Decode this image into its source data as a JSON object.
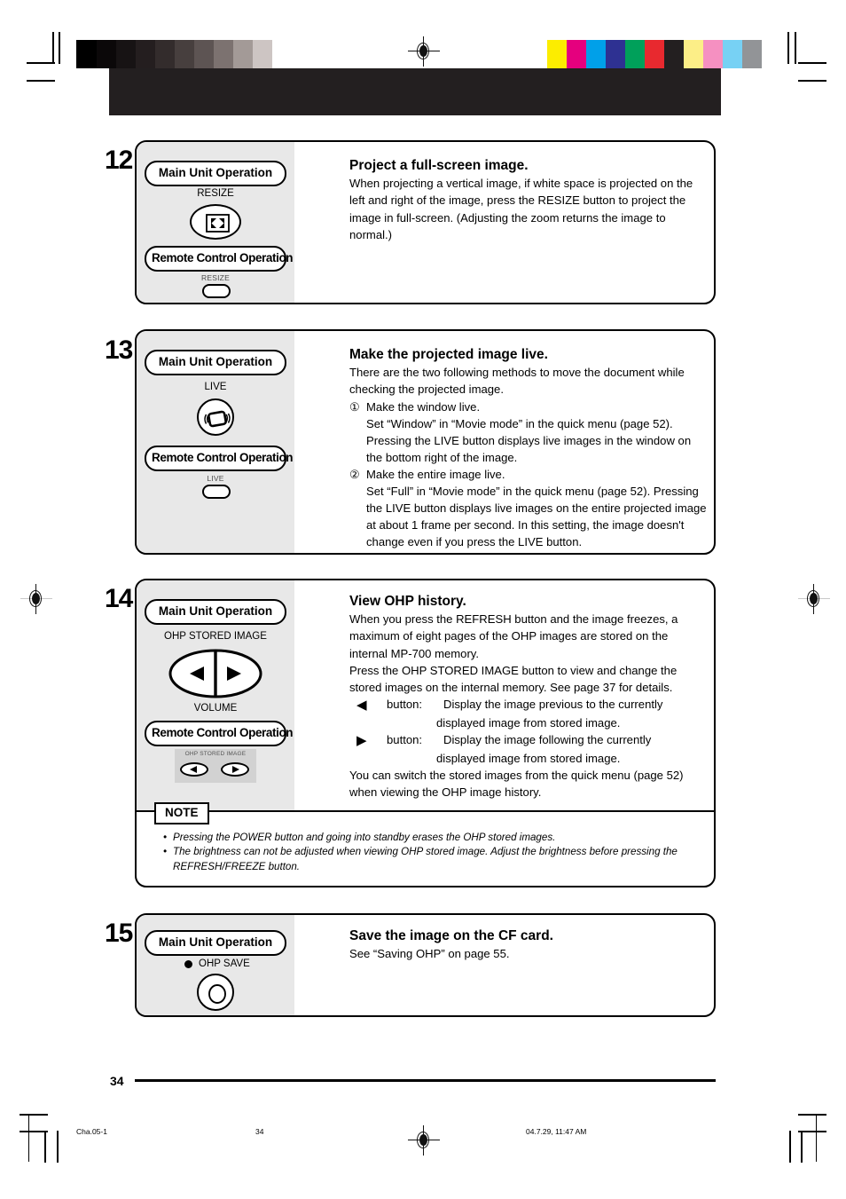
{
  "document": {
    "page_number": "34",
    "footer_file": "Cha.05-1",
    "footer_page": "34",
    "footer_timestamp": "04.7.29, 11:47 AM"
  },
  "labels": {
    "main_unit": "Main Unit Operation",
    "remote_control": "Remote Control Operation"
  },
  "colorbars": {
    "gray_swatches": [
      "#000000",
      "#0b0809",
      "#171314",
      "#241e1f",
      "#332c2c",
      "#473f3e",
      "#5d5453",
      "#7c7270",
      "#a39a97",
      "#cdc5c3",
      "#ffffff"
    ],
    "color_swatches": [
      "#fced00",
      "#e5007e",
      "#00a0e9",
      "#2e3192",
      "#00a05a",
      "#e8292f",
      "#231f20",
      "#fcee87",
      "#f590c1",
      "#77d1f4",
      "#929497"
    ]
  },
  "steps": [
    {
      "number": "12",
      "main_caption": "RESIZE",
      "main_icon": "resize-icon",
      "remote_caption": "RESIZE",
      "heading": "Project a full-screen image.",
      "body": "When projecting a vertical image, if white space is projected on the left and right of the image, press the RESIZE button to project the image in full-screen. (Adjusting the zoom returns the image to normal.)"
    },
    {
      "number": "13",
      "main_caption": "LIVE",
      "main_icon": "live-icon",
      "remote_caption": "LIVE",
      "heading": "Make the projected image live.",
      "intro": "There are the two following methods to move the document while checking the projected image.",
      "items": [
        {
          "marker": "①",
          "title": "Make the window live.",
          "detail": "Set “Window” in “Movie mode” in the quick menu (page 52). Pressing the LIVE button displays live images in the window on the bottom right of the image."
        },
        {
          "marker": "②",
          "title": "Make the entire image live.",
          "detail": "Set “Full” in “Movie mode” in the quick menu (page 52). Pressing the LIVE button displays live images on the entire projected image at about 1 frame per second. In this setting, the image doesn't change even if you press the LIVE button."
        }
      ]
    },
    {
      "number": "14",
      "main_caption": "OHP STORED IMAGE",
      "main_caption_bottom": "VOLUME",
      "remote_caption": "OHP STORED IMAGE",
      "heading": "View OHP history.",
      "body1": "When you press the REFRESH button and the image freezes, a maximum of eight pages of the OHP images are stored on the internal MP-700 memory.",
      "body2": "Press the OHP STORED IMAGE button to view and change the stored images on the internal memory. See page 37 for details.",
      "button_rows": [
        {
          "glyph": "◀",
          "label": "button:",
          "text": "Display the image previous to the currently",
          "text2": "displayed image from stored image."
        },
        {
          "glyph": "▶",
          "label": "button:",
          "text": "Display the image following the currently",
          "text2": "displayed image from stored image."
        }
      ],
      "body3": "You can switch the stored images from the quick menu (page 52) when viewing the OHP image history.",
      "note": {
        "tag": "NOTE",
        "bullets": [
          "Pressing the POWER button and going into standby erases the OHP stored images.",
          "The brightness can not be adjusted when viewing OHP stored image. Adjust the brightness before pressing the REFRESH/FREEZE button."
        ]
      }
    },
    {
      "number": "15",
      "main_caption": "OHP SAVE",
      "main_icon": "ohp-save-icon",
      "heading": "Save the image on the CF card.",
      "body": "See “Saving OHP” on page 55."
    }
  ]
}
